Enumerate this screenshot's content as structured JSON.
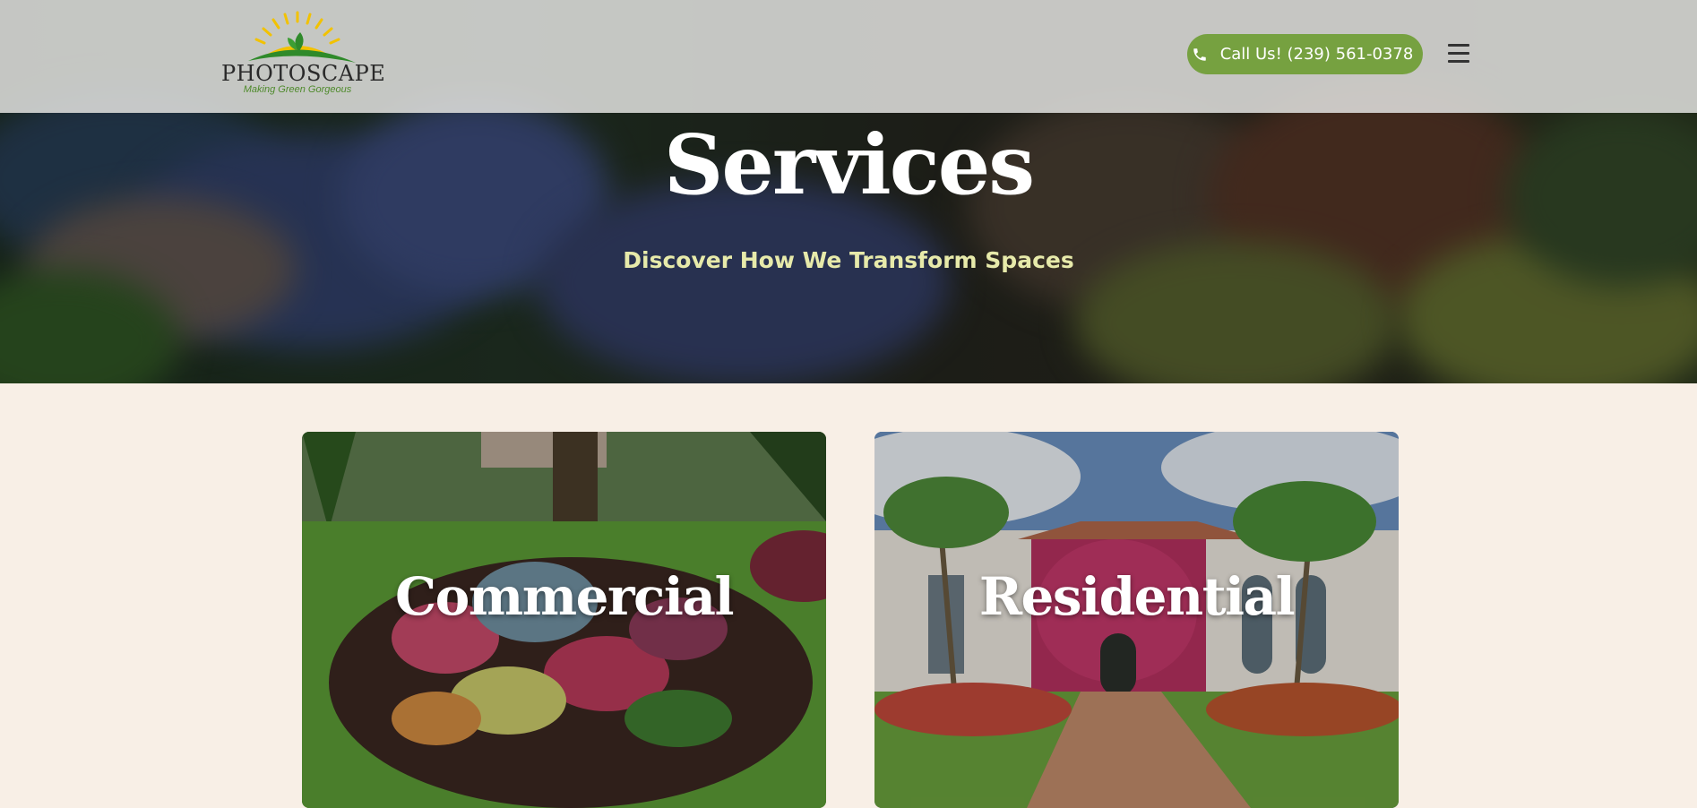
{
  "header": {
    "logo": {
      "name": "PHOTOSCAPE",
      "tagline": "Making Green Gorgeous"
    },
    "call_button": {
      "label": "Call Us! (239) 561-0378",
      "icon": "phone-icon"
    },
    "menu_icon": "hamburger-menu-icon"
  },
  "hero": {
    "title": "Services",
    "subtitle": "Discover How We Transform Spaces"
  },
  "cards": [
    {
      "label": "Commercial"
    },
    {
      "label": "Residential"
    }
  ],
  "colors": {
    "accent_green": "#76a140",
    "page_background": "#f8efe6",
    "subtitle_color": "#e7eaaa",
    "header_background": "#e2e2e0"
  }
}
